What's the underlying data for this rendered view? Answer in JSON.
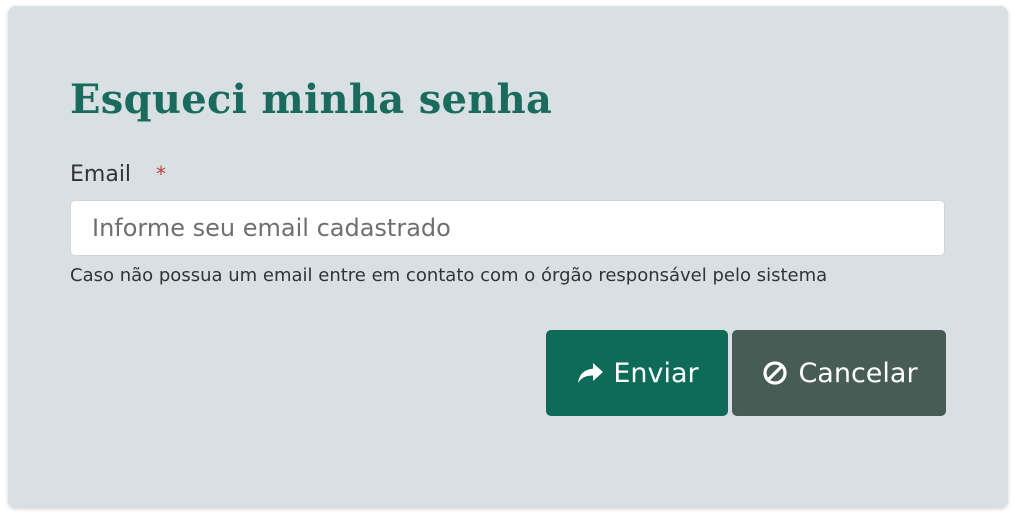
{
  "form": {
    "title": "Esqueci minha senha",
    "email_label": "Email",
    "required_marker": "*",
    "email_value": "",
    "email_placeholder": "Informe seu email cadastrado",
    "help_text": "Caso não possua um email entre em contato com o órgão responsável pelo sistema"
  },
  "buttons": {
    "send_label": "Enviar",
    "send_icon": "share-arrow-icon",
    "cancel_label": "Cancelar",
    "cancel_icon": "ban-icon"
  },
  "colors": {
    "card_background": "#d8e0e3",
    "title": "#1a6b5e",
    "required_star": "#b5443b",
    "send_button": "#0d6b58",
    "cancel_button": "#485c56"
  }
}
